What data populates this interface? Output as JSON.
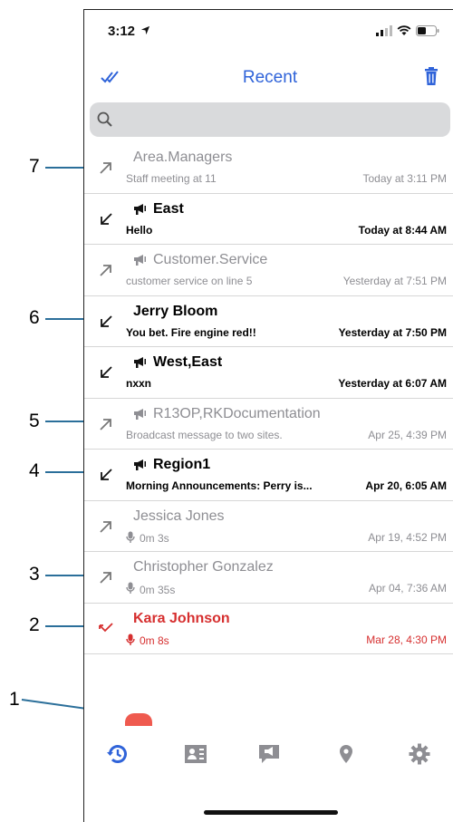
{
  "status_bar": {
    "time": "3:12"
  },
  "nav": {
    "title": "Recent"
  },
  "search": {
    "placeholder": "",
    "value": ""
  },
  "rows": [
    {
      "name": "Area.Managers",
      "message": "Staff meeting at 11",
      "timestamp": "Today at 3:11 PM",
      "direction": "outgoing",
      "style": "gray",
      "group": false,
      "voice": false
    },
    {
      "name": "East",
      "message": "Hello",
      "timestamp": "Today at 8:44 AM",
      "direction": "incoming",
      "style": "bold",
      "group": true,
      "voice": false
    },
    {
      "name": "Customer.Service",
      "message": "customer service on line 5",
      "timestamp": "Yesterday at 7:51 PM",
      "direction": "outgoing",
      "style": "gray",
      "group": true,
      "voice": false
    },
    {
      "name": "Jerry Bloom",
      "message": "You bet. Fire engine red!!",
      "timestamp": "Yesterday at 7:50 PM",
      "direction": "incoming",
      "style": "bold",
      "group": false,
      "voice": false
    },
    {
      "name": "West,East",
      "message": "nxxn",
      "timestamp": "Yesterday at 6:07 AM",
      "direction": "incoming",
      "style": "bold",
      "group": true,
      "voice": false
    },
    {
      "name": "R13OP,RKDocumentation",
      "message": "Broadcast message to two sites.",
      "timestamp": "Apr 25, 4:39 PM",
      "direction": "outgoing",
      "style": "gray",
      "group": true,
      "voice": false
    },
    {
      "name": "Region1",
      "message": "Morning Announcements: Perry is...",
      "timestamp": "Apr 20, 6:05 AM",
      "direction": "incoming",
      "style": "bold",
      "group": true,
      "voice": false
    },
    {
      "name": "Jessica Jones",
      "message": "0m 3s",
      "timestamp": "Apr 19, 4:52 PM",
      "direction": "outgoing",
      "style": "gray",
      "group": false,
      "voice": true
    },
    {
      "name": "Christopher Gonzalez",
      "message": "0m 35s",
      "timestamp": "Apr 04, 7:36 AM",
      "direction": "outgoing",
      "style": "gray",
      "group": false,
      "voice": true
    },
    {
      "name": "Kara Johnson",
      "message": "0m 8s",
      "timestamp": "Mar 28, 4:30 PM",
      "direction": "missed",
      "style": "red",
      "group": false,
      "voice": true
    }
  ],
  "tabs": [
    {
      "icon": "recent-clock-icon",
      "active": true
    },
    {
      "icon": "contacts-icon",
      "active": false
    },
    {
      "icon": "broadcast-message-icon",
      "active": false
    },
    {
      "icon": "location-pin-icon",
      "active": false
    },
    {
      "icon": "settings-gear-icon",
      "active": false
    }
  ],
  "callouts": [
    {
      "label": "7",
      "row": 0
    },
    {
      "label": "6",
      "row": 3
    },
    {
      "label": "5",
      "row": 5
    },
    {
      "label": "4",
      "row": 6
    },
    {
      "label": "3",
      "row": 8
    },
    {
      "label": "2",
      "row": 9
    },
    {
      "label": "1",
      "target": "broadcast-tab"
    }
  ],
  "colors": {
    "accent": "#2f63d9",
    "gray_text": "#8e8e93",
    "missed_red": "#d62f2f",
    "callout_line": "#2b6f9a"
  }
}
